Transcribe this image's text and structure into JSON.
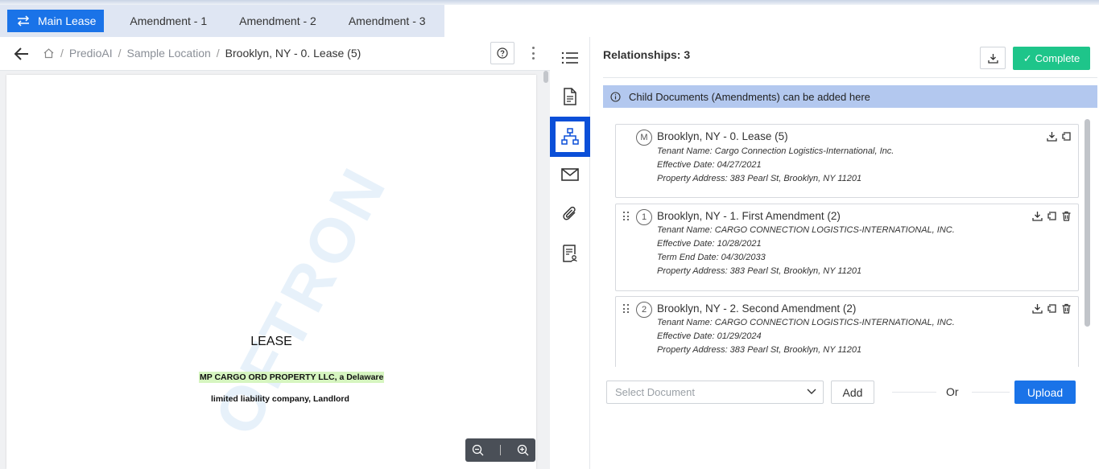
{
  "tabs": [
    {
      "label": "Main Lease",
      "active": true,
      "icon": "swap-arrows-icon"
    },
    {
      "label": "Amendment - 1"
    },
    {
      "label": "Amendment - 2"
    },
    {
      "label": "Amendment - 3"
    }
  ],
  "breadcrumb": {
    "items": [
      "PredioAI",
      "Sample Location"
    ],
    "current": "Brooklyn, NY - 0. Lease (5)"
  },
  "document": {
    "title": "LEASE",
    "line1": "MP CARGO ORD PROPERTY LLC, a Delaware",
    "line2": "limited liability company, Landlord",
    "watermark": "OFTRON"
  },
  "rail": [
    "list-icon",
    "document-icon",
    "sitemap-icon",
    "mail-icon",
    "paperclip-icon",
    "report-icon"
  ],
  "relationships": {
    "title": "Relationships: 3",
    "complete_label": "Complete",
    "info": "Child Documents (Amendments) can be added here",
    "items": [
      {
        "badge": "M",
        "title": "Brooklyn, NY - 0. Lease (5)",
        "lines": [
          "Tenant Name: Cargo Connection Logistics-International, Inc.",
          "Effective Date: 04/27/2021",
          "Property Address: 383 Pearl St, Brooklyn, NY 11201"
        ]
      },
      {
        "badge": "1",
        "title": "Brooklyn, NY - 1. First Amendment (2)",
        "lines": [
          "Tenant Name: CARGO CONNECTION LOGISTICS-INTERNATIONAL, INC.",
          "Effective Date: 10/28/2021",
          "Term End Date: 04/30/2033",
          "Property Address: 383 Pearl St, Brooklyn, NY 11201"
        ]
      },
      {
        "badge": "2",
        "title": "Brooklyn, NY - 2. Second Amendment (2)",
        "lines": [
          "Tenant Name: CARGO CONNECTION LOGISTICS-INTERNATIONAL, INC.",
          "Effective Date: 01/29/2024",
          "Property Address: 383 Pearl St, Brooklyn, NY 11201"
        ]
      }
    ],
    "select_placeholder": "Select Document",
    "add_label": "Add",
    "or_label": "Or",
    "upload_label": "Upload"
  },
  "colors": {
    "accent": "#1a73e8",
    "complete": "#1ec58a",
    "info_bar": "#b3c8ef",
    "rail_active": "#0b4fd8"
  }
}
